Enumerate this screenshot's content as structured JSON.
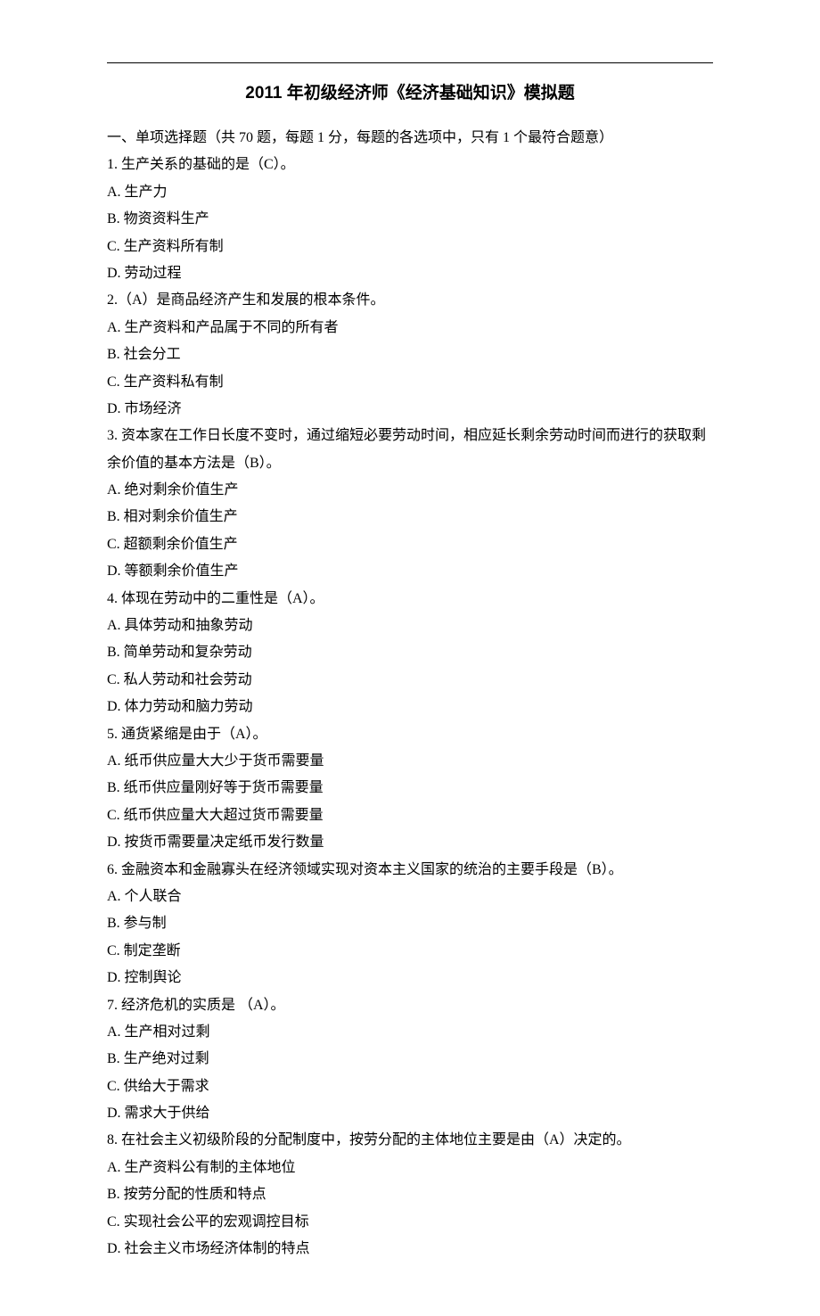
{
  "title": "2011 年初级经济师《经济基础知识》模拟题",
  "section_heading": "一、单项选择题（共 70 题，每题 1 分，每题的各选项中，只有 1 个最符合题意）",
  "questions": [
    {
      "stem": "1. 生产关系的基础的是（C）。",
      "options": [
        "A. 生产力",
        "B. 物资资料生产",
        "C. 生产资料所有制",
        "D. 劳动过程"
      ]
    },
    {
      "stem": "2.（A）是商品经济产生和发展的根本条件。",
      "options": [
        "A. 生产资料和产品属于不同的所有者",
        "B. 社会分工",
        "C. 生产资料私有制",
        "D. 市场经济"
      ]
    },
    {
      "stem": "3. 资本家在工作日长度不变时，通过缩短必要劳动时间，相应延长剩余劳动时间而进行的获取剩余价值的基本方法是（B）。",
      "options": [
        "A. 绝对剩余价值生产",
        "B. 相对剩余价值生产",
        "C. 超额剩余价值生产",
        "D. 等额剩余价值生产"
      ]
    },
    {
      "stem": "4. 体现在劳动中的二重性是（A）。",
      "options": [
        "A. 具体劳动和抽象劳动",
        "B. 简单劳动和复杂劳动",
        "C. 私人劳动和社会劳动",
        "D. 体力劳动和脑力劳动"
      ]
    },
    {
      "stem": "5. 通货紧缩是由于（A）。",
      "options": [
        "A. 纸币供应量大大少于货币需要量",
        "B. 纸币供应量刚好等于货币需要量",
        "C. 纸币供应量大大超过货币需要量",
        "D. 按货币需要量决定纸币发行数量"
      ]
    },
    {
      "stem": "6. 金融资本和金融寡头在经济领域实现对资本主义国家的统治的主要手段是（B）。",
      "options": [
        "A. 个人联合",
        "B. 参与制",
        "C. 制定垄断",
        "D. 控制舆论"
      ]
    },
    {
      "stem": "7. 经济危机的实质是 （A）。",
      "options": [
        "A. 生产相对过剩",
        "B. 生产绝对过剩",
        "C. 供给大于需求",
        "D. 需求大于供给"
      ]
    },
    {
      "stem": "8. 在社会主义初级阶段的分配制度中，按劳分配的主体地位主要是由（A）决定的。",
      "options": [
        "A. 生产资料公有制的主体地位",
        "B. 按劳分配的性质和特点",
        "C. 实现社会公平的宏观调控目标",
        "D. 社会主义市场经济体制的特点"
      ]
    }
  ]
}
